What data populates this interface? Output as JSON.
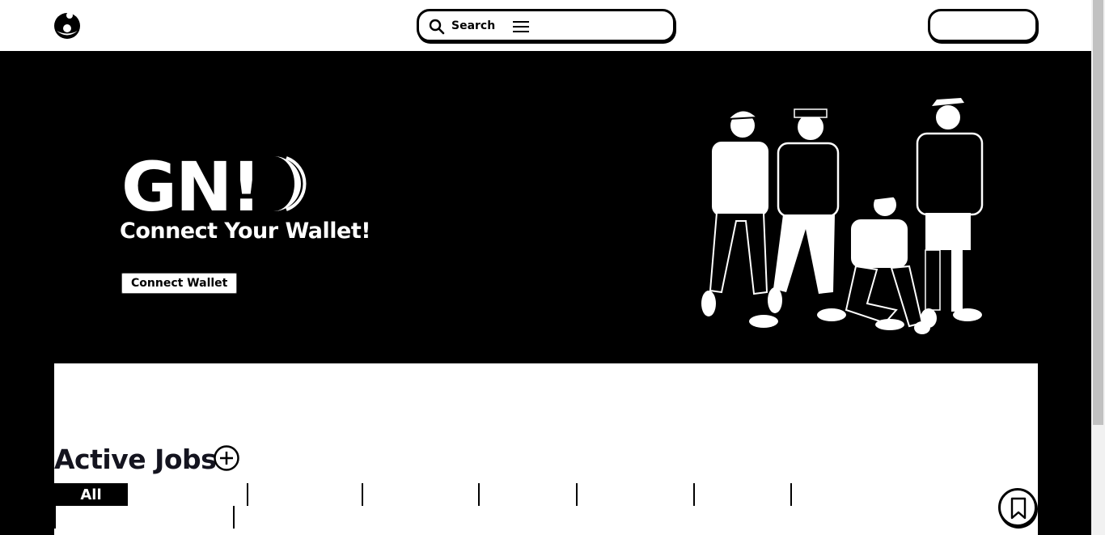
{
  "header": {
    "search_label": "Search",
    "right_button_label": ""
  },
  "hero": {
    "brand": "GN!",
    "subtitle": "Connect Your Wallet!",
    "connect_button": "Connect Wallet"
  },
  "main": {
    "title": "Active Jobs",
    "tabs": [
      {
        "label": "All",
        "active": true
      },
      {
        "label": ""
      },
      {
        "label": ""
      },
      {
        "label": ""
      },
      {
        "label": ""
      },
      {
        "label": ""
      },
      {
        "label": ""
      },
      {
        "label": ""
      }
    ]
  },
  "icons": [
    "donut-logo-icon",
    "search-icon",
    "menu-icon",
    "add-icon",
    "bookmark-icon"
  ],
  "colors": {
    "primary": "#000000",
    "background": "#ffffff",
    "title": "#14141f"
  }
}
